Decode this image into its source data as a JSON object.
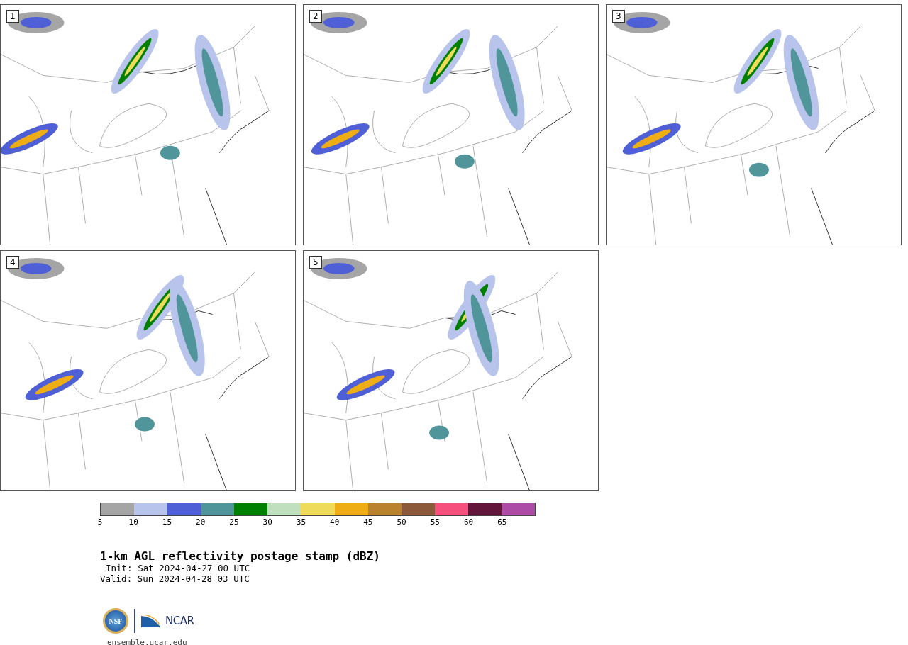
{
  "panels": [
    {
      "label": "1"
    },
    {
      "label": "2"
    },
    {
      "label": "3"
    },
    {
      "label": "4"
    },
    {
      "label": "5"
    }
  ],
  "colorbar": {
    "segments": [
      {
        "color": "#a5a5a5"
      },
      {
        "color": "#b8c4ec"
      },
      {
        "color": "#4f5fd6"
      },
      {
        "color": "#4f9599"
      },
      {
        "color": "#008000"
      },
      {
        "color": "#bfdfbf"
      },
      {
        "color": "#eedb5a"
      },
      {
        "color": "#efad15"
      },
      {
        "color": "#b9822f"
      },
      {
        "color": "#8b5a3b"
      },
      {
        "color": "#f5507e"
      },
      {
        "color": "#62173a"
      },
      {
        "color": "#ad4ca6"
      }
    ],
    "ticks": [
      "5",
      "10",
      "15",
      "20",
      "25",
      "30",
      "35",
      "40",
      "45",
      "50",
      "55",
      "60",
      "65"
    ]
  },
  "title": "1-km AGL reflectivity postage stamp (dBZ)",
  "init": "Init: Sat 2024-04-27 00 UTC",
  "valid": "Valid: Sun 2024-04-28 03 UTC",
  "logo": {
    "left": "NSF",
    "right": "NCAR"
  },
  "footer": "ensemble.ucar.edu"
}
